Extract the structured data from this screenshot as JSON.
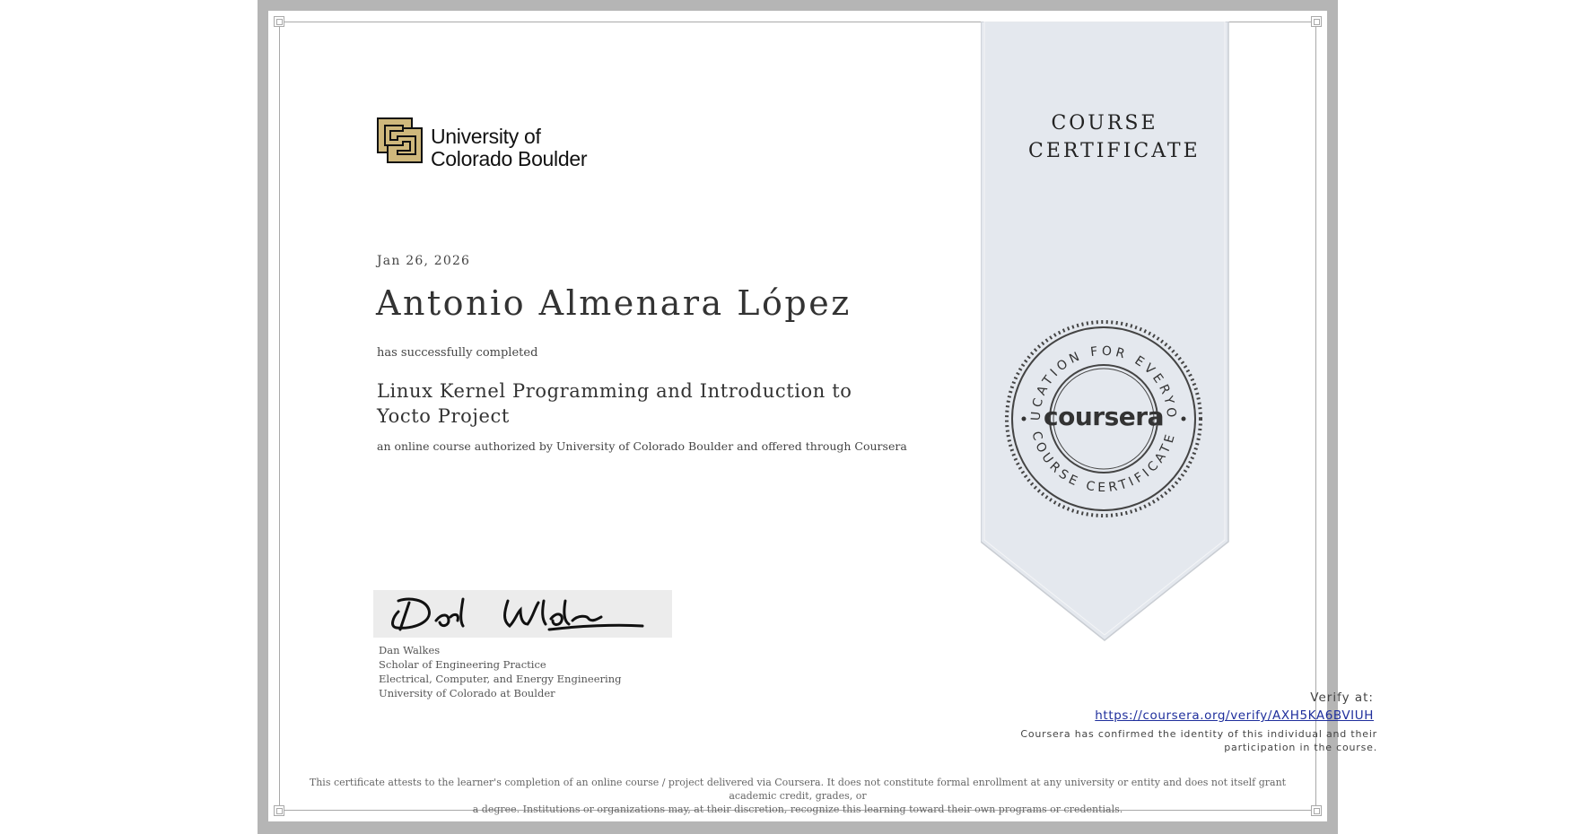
{
  "institution": {
    "logo_icon": "cu-logo-icon",
    "name": "University of Colorado Boulder"
  },
  "certificate": {
    "ribbon_title": "COURSE CERTIFICATE",
    "date": "Jan 26, 2026",
    "recipient": "Antonio Almenara López",
    "completed_text": "has successfully completed",
    "course_title": "Linux Kernel Programming and Introduction to Yocto Project",
    "authorization": "an online course authorized by University of Colorado Boulder and offered through Coursera"
  },
  "seal": {
    "brand": "coursera",
    "ring_top": "EDUCATION FOR EVERYONE",
    "ring_bottom": "COURSE CERTIFICATE"
  },
  "signatory": {
    "signature_icon": "signature-icon",
    "name": "Dan Walkes",
    "title": "Scholar of Engineering Practice",
    "department": "Electrical, Computer, and Energy Engineering",
    "institution": "University of Colorado at Boulder"
  },
  "verification": {
    "label": "Verify at:",
    "url": "https://coursera.org/verify/AXH5KA6BVIUH",
    "identity_line1": "Coursera has confirmed the identity of this individual and their",
    "identity_line2": "participation in the course."
  },
  "disclaimer": {
    "line1": "This certificate attests to the learner's completion of an online course / project delivered via Coursera. It does not constitute formal enrollment at any university or entity and does not itself grant academic credit, grades, or",
    "line2": "a degree. Institutions or organizations may, at their discretion, recognize this learning toward their own programs or credentials."
  },
  "colors": {
    "frame": "#b5b5b5",
    "ribbon": "#e4e8ee",
    "link": "#1f2f9c",
    "logo_gold": "#cfb87c"
  }
}
